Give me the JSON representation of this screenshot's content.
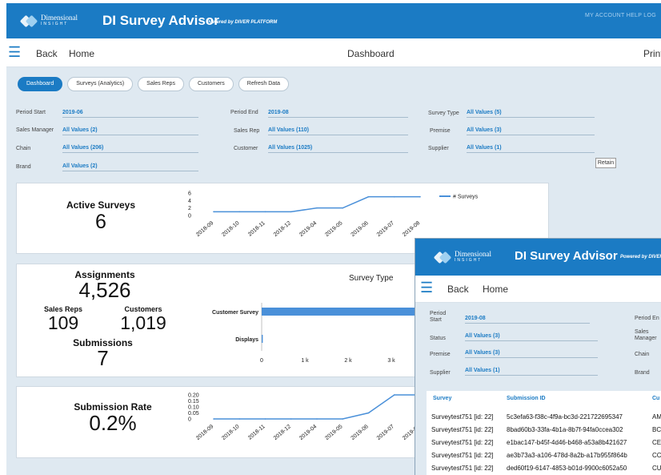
{
  "app": {
    "logo_line1": "Dimensional",
    "logo_line2": "INSIGHT",
    "title": "DI Survey Advisor",
    "powered_by": "Powered by DIVER PLATFORM",
    "account_links": "MY ACCOUNT  HELP  LOG"
  },
  "nav": {
    "back": "Back",
    "home": "Home",
    "center_title": "Dashboard",
    "print": "Print"
  },
  "tabs": [
    "Dashboard",
    "Surveys (Analytics)",
    "Sales Reps",
    "Customers",
    "Refresh Data"
  ],
  "filters": {
    "period_start": {
      "label": "Period Start",
      "value": "2019-06"
    },
    "period_end": {
      "label": "Period End",
      "value": "2019-08"
    },
    "survey_type": {
      "label": "Survey Type",
      "value": "All Values (5)"
    },
    "sales_manager": {
      "label": "Sales Manager",
      "value": "All Values (2)"
    },
    "sales_rep": {
      "label": "Sales Rep",
      "value": "All Values (110)"
    },
    "premise": {
      "label": "Premise",
      "value": "All Values (3)"
    },
    "chain": {
      "label": "Chain",
      "value": "All Values (206)"
    },
    "customer": {
      "label": "Customer",
      "value": "All Values (1025)"
    },
    "supplier": {
      "label": "Supplier",
      "value": "All Values (1)"
    },
    "brand": {
      "label": "Brand",
      "value": "All Values (2)"
    },
    "button": "Retain"
  },
  "kpis": {
    "active_surveys": {
      "label": "Active Surveys",
      "value": "6"
    },
    "assignments": {
      "label": "Assignments",
      "value": "4,526"
    },
    "sales_reps": {
      "label": "Sales Reps",
      "value": "109"
    },
    "customers": {
      "label": "Customers",
      "value": "1,019"
    },
    "submissions": {
      "label": "Submissions",
      "value": "7"
    },
    "submission_rate": {
      "label": "Submission Rate",
      "value": "0.2%"
    }
  },
  "chart_data": [
    {
      "type": "line",
      "x": [
        "2018-09",
        "2018-10",
        "2018-11",
        "2018-12",
        "2019-04",
        "2019-05",
        "2019-06",
        "2019-07",
        "2019-08"
      ],
      "series": [
        {
          "name": "# Surveys",
          "values": [
            1,
            1,
            1,
            1,
            2,
            2,
            5,
            5,
            5
          ]
        }
      ],
      "yticks": [
        "6",
        "4",
        "2",
        "0"
      ],
      "ylim": [
        0,
        6
      ],
      "legend": "right",
      "color": "#4a90d9"
    },
    {
      "type": "bar",
      "title": "Survey Type",
      "categories": [
        "Customer Survey",
        "Displays"
      ],
      "values": [
        4500,
        26
      ],
      "xticks": [
        "0",
        "1 k",
        "2 k",
        "3 k"
      ],
      "color": "#4a90d9"
    },
    {
      "type": "line",
      "x": [
        "2018-09",
        "2018-10",
        "2018-11",
        "2018-12",
        "2019-04",
        "2019-05",
        "2019-06",
        "2019-07",
        "2019-08"
      ],
      "series": [
        {
          "values": [
            0,
            0,
            0,
            0,
            0,
            0,
            0.05,
            0.2,
            0.2
          ]
        }
      ],
      "yticks": [
        "0.20",
        "0.15",
        "0.10",
        "0.05",
        "0"
      ],
      "ylim": [
        0,
        0.2
      ],
      "color": "#4a90d9"
    }
  ],
  "overlay": {
    "filters": {
      "period_start": {
        "label": "Period Start",
        "value": "2019-08"
      },
      "period_end": {
        "label": "Period En"
      },
      "status": {
        "label": "Status",
        "value": "All Values (3)"
      },
      "sales_manager": {
        "label": "Sales Manager"
      },
      "premise": {
        "label": "Premise",
        "value": "All Values (3)"
      },
      "chain": {
        "label": "Chain"
      },
      "supplier": {
        "label": "Supplier",
        "value": "All Values (1)"
      },
      "brand": {
        "label": "Brand"
      }
    },
    "table": {
      "headers": [
        "Survey",
        "Submission ID",
        "Cu"
      ],
      "rows": [
        [
          "Surveytest751 [id: 22]",
          "5c3efa63-f38c-4f9a-bc3d-221722695347",
          "AM"
        ],
        [
          "Surveytest751 [id: 22]",
          "8bad60b3-33fa-4b1a-8b7f-94fa0ccea302",
          "BC"
        ],
        [
          "Surveytest751 [id: 22]",
          "e1bac147-b45f-4d46-b468-a53a8b421627",
          "CE"
        ],
        [
          "Surveytest751 [id: 22]",
          "ae3b73a3-a106-478d-8a2b-a17b955f864b",
          "CC"
        ],
        [
          "Surveytest751 [id: 22]",
          "ded60f19-6147-4853-b01d-9900c6052a50",
          "CU"
        ]
      ]
    }
  }
}
